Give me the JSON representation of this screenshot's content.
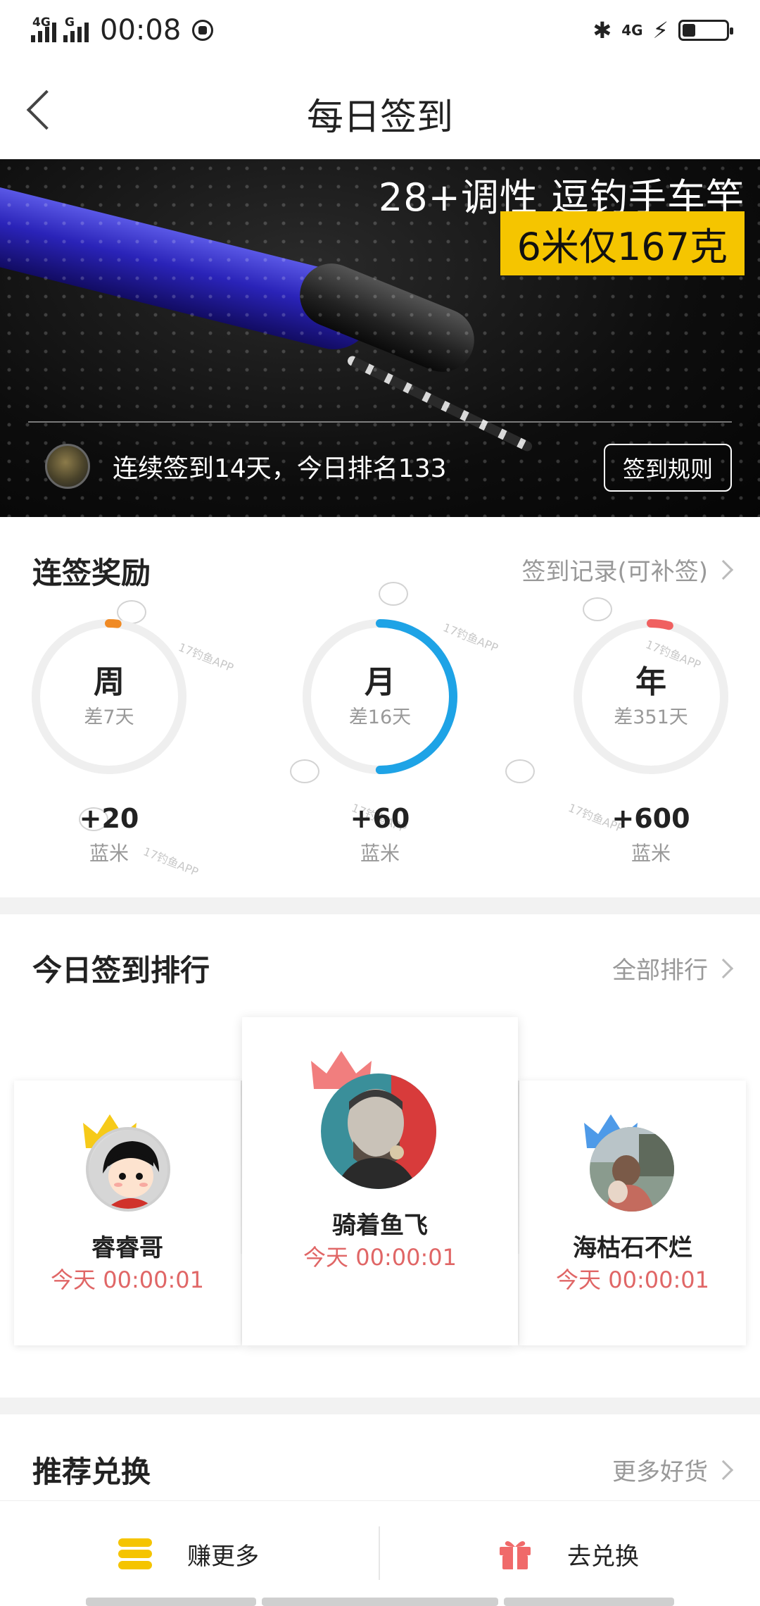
{
  "status_bar": {
    "network_left": "4G",
    "network_left2": "G",
    "time": "00:08",
    "network_right": "4G"
  },
  "nav": {
    "title": "每日签到"
  },
  "banner": {
    "headline": "28+调性 逗钓手车竿",
    "tag": "6米仅167克",
    "checkin_text": "连续签到14天，今日排名133",
    "rules_button": "签到规则"
  },
  "streak_rewards": {
    "title": "连签奖励",
    "link": "签到记录(可补签)",
    "items": [
      {
        "label": "周",
        "remaining": "差7天",
        "reward": "+20",
        "unit": "蓝米",
        "progress": 0.0,
        "color": "#f08a24"
      },
      {
        "label": "月",
        "remaining": "差16天",
        "reward": "+60",
        "unit": "蓝米",
        "progress": 0.5,
        "color": "#1ea3e6"
      },
      {
        "label": "年",
        "remaining": "差351天",
        "reward": "+600",
        "unit": "蓝米",
        "progress": 0.04,
        "color": "#f06060"
      }
    ]
  },
  "ranking": {
    "title": "今日签到排行",
    "link": "全部排行",
    "users": [
      {
        "rank": 2,
        "name": "睿睿哥",
        "time": "今天 00:00:01",
        "crown_color": "#f5c400"
      },
      {
        "rank": 1,
        "name": "骑着鱼飞",
        "time": "今天 00:00:01",
        "crown_color": "#f07070"
      },
      {
        "rank": 3,
        "name": "海枯石不烂",
        "time": "今天 00:00:01",
        "crown_color": "#3b8fe6"
      }
    ]
  },
  "recommend": {
    "title": "推荐兑换",
    "link": "更多好货"
  },
  "bottom_bar": {
    "earn_label": "赚更多",
    "redeem_label": "去兑换"
  },
  "watermark_text": "17钓鱼APP"
}
